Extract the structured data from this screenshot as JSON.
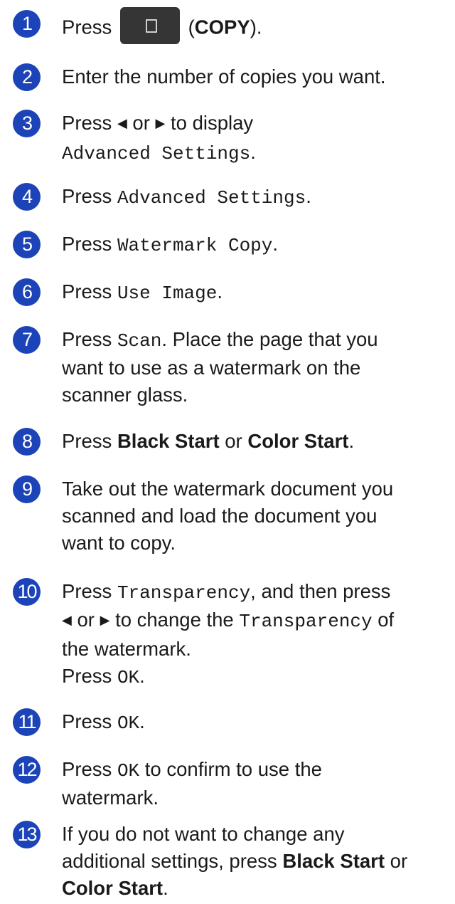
{
  "steps": {
    "s1": {
      "num": "1",
      "a": "Press",
      "b": "(",
      "c": "COPY",
      "d": ")."
    },
    "s2": {
      "num": "2",
      "a": "Enter the number of copies you want."
    },
    "s3": {
      "num": "3",
      "a": "Press",
      "left": "◀",
      "or": "or",
      "right": "▶",
      "b": "to display",
      "c": "Advanced Settings",
      "d": "."
    },
    "s4": {
      "num": "4",
      "a": "Press",
      "c": "Advanced Settings",
      "d": "."
    },
    "s5": {
      "num": "5",
      "a": "Press",
      "c": "Watermark Copy",
      "d": "."
    },
    "s6": {
      "num": "6",
      "a": "Press",
      "c": "Use Image",
      "d": "."
    },
    "s7": {
      "num": "7",
      "a": "Press",
      "c": "Scan",
      "d": ". Place the page that you",
      "e": "want to use as a watermark on the",
      "f": "scanner glass."
    },
    "s8": {
      "num": "8",
      "a": "Press",
      "b": "Black Start",
      "or": "or",
      "c": "Color Start",
      "d": "."
    },
    "s9": {
      "num": "9",
      "a": "Take out the watermark document you",
      "b": "scanned and load the document you",
      "c": "want to copy."
    },
    "s10": {
      "num": "10",
      "a": "Press",
      "c": "Transparency",
      "d": ", and then press",
      "left": "◀",
      "or": "or",
      "right": "▶",
      "e": "to change the",
      "f": "Transparency",
      "g": "of",
      "h": "the watermark.",
      "i": "Press",
      "ok": "OK",
      "j": "."
    },
    "s11": {
      "num": "11",
      "a": "Press",
      "c": "OK",
      "d": "."
    },
    "s12": {
      "num": "12",
      "a": "Press",
      "c": "OK",
      "d": "to confirm to use the",
      "e": "watermark."
    },
    "s13": {
      "num": "13",
      "a": "If you do not want to change any",
      "b": "additional settings, press",
      "c": "Black Start",
      "or": "or",
      "e": "Color Start",
      "f": "."
    }
  },
  "icons": {
    "copy": "copy-icon"
  },
  "colors": {
    "step_circle": "#1c44b8",
    "button": "#353535",
    "text": "#1a1a1a"
  }
}
